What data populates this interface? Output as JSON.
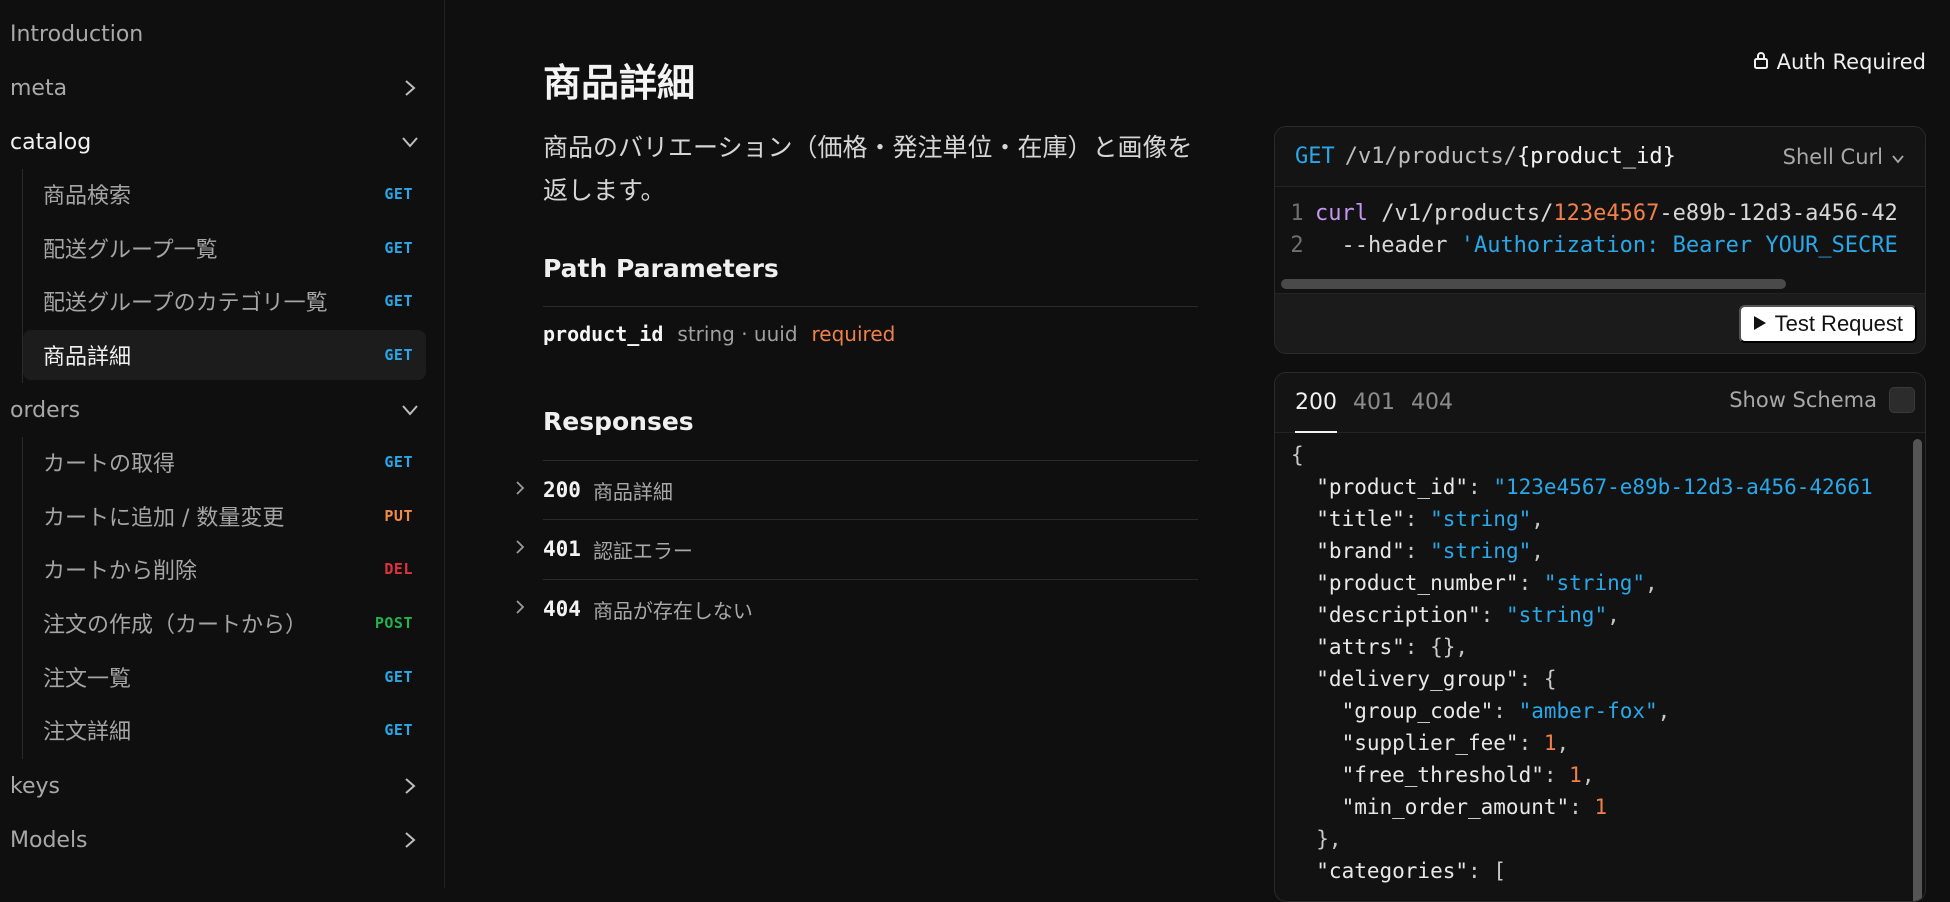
{
  "sidebar": {
    "top_items": [
      "Introduction"
    ],
    "groups": [
      {
        "label": "meta",
        "expanded": false
      },
      {
        "label": "catalog",
        "expanded": true,
        "items": [
          {
            "label": "商品検索",
            "method": "GET"
          },
          {
            "label": "配送グループ一覧",
            "method": "GET"
          },
          {
            "label": "配送グループのカテゴリ一覧",
            "method": "GET"
          },
          {
            "label": "商品詳細",
            "method": "GET",
            "selected": true
          }
        ]
      },
      {
        "label": "orders",
        "expanded": true,
        "items": [
          {
            "label": "カートの取得",
            "method": "GET"
          },
          {
            "label": "カートに追加 / 数量変更",
            "method": "PUT"
          },
          {
            "label": "カートから削除",
            "method": "DEL"
          },
          {
            "label": "注文の作成（カートから）",
            "method": "POST"
          },
          {
            "label": "注文一覧",
            "method": "GET"
          },
          {
            "label": "注文詳細",
            "method": "GET"
          }
        ]
      },
      {
        "label": "keys",
        "expanded": false
      },
      {
        "label": "Models",
        "expanded": false
      }
    ]
  },
  "main": {
    "title": "商品詳細",
    "auth_label": "Auth Required",
    "description": "商品のバリエーション（価格・発注単位・在庫）と画像を返します。",
    "path_params_heading": "Path Parameters",
    "param": {
      "name": "product_id",
      "type": "string · uuid",
      "required": "required"
    },
    "responses_heading": "Responses",
    "responses": [
      {
        "code": "200",
        "label": "商品詳細"
      },
      {
        "code": "401",
        "label": "認証エラー"
      },
      {
        "code": "404",
        "label": "商品が存在しない"
      }
    ]
  },
  "request": {
    "method": "GET",
    "path_prefix": "/v1/products/",
    "path_param": "{product_id}",
    "shell": "Shell Curl",
    "lines": [
      {
        "n": "1",
        "cmd": "curl",
        "p1": " /v1/products/",
        "num": "123e4567",
        "p2": "-e89b-12d3-a456-42"
      },
      {
        "n": "2",
        "p1": "  --header ",
        "str": "'Authorization: Bearer YOUR_SECRE"
      }
    ],
    "test_label": "Test Request"
  },
  "response": {
    "tabs": [
      "200",
      "401",
      "404"
    ],
    "active_tab": "200",
    "schema_label": "Show Schema",
    "json_lines": [
      {
        "t": "{"
      },
      {
        "k": "  \"product_id\"",
        "sep": ": ",
        "s": "\"123e4567-e89b-12d3-a456-42661"
      },
      {
        "k": "  \"title\"",
        "sep": ": ",
        "s": "\"string\"",
        "end": ","
      },
      {
        "k": "  \"brand\"",
        "sep": ": ",
        "s": "\"string\"",
        "end": ","
      },
      {
        "k": "  \"product_number\"",
        "sep": ": ",
        "s": "\"string\"",
        "end": ","
      },
      {
        "k": "  \"description\"",
        "sep": ": ",
        "s": "\"string\"",
        "end": ","
      },
      {
        "k": "  \"attrs\"",
        "sep": ": ",
        "t2": "{},"
      },
      {
        "k": "  \"delivery_group\"",
        "sep": ": ",
        "t2": "{"
      },
      {
        "k": "    \"group_code\"",
        "sep": ": ",
        "s": "\"amber-fox\"",
        "end": ","
      },
      {
        "k": "    \"supplier_fee\"",
        "sep": ": ",
        "num": "1",
        "end": ","
      },
      {
        "k": "    \"free_threshold\"",
        "sep": ": ",
        "num": "1",
        "end": ","
      },
      {
        "k": "    \"min_order_amount\"",
        "sep": ": ",
        "num": "1"
      },
      {
        "t": "  },"
      },
      {
        "k": "  \"categories\"",
        "sep": ": ",
        "t2": "["
      }
    ]
  }
}
